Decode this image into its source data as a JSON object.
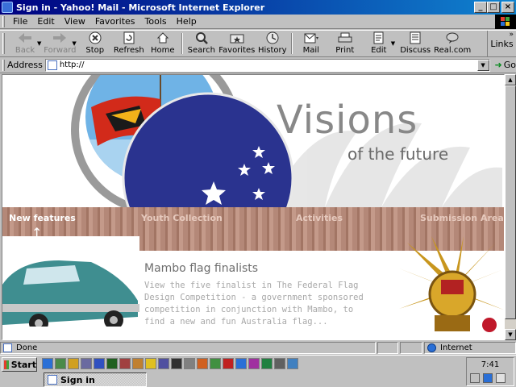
{
  "window": {
    "title": "Sign in - Yahoo! Mail - Microsoft Internet Explorer"
  },
  "menu": [
    "File",
    "Edit",
    "View",
    "Favorites",
    "Tools",
    "Help"
  ],
  "toolbar": {
    "back": "Back",
    "forward": "Forward",
    "stop": "Stop",
    "refresh": "Refresh",
    "home": "Home",
    "search": "Search",
    "favorites": "Favorites",
    "history": "History",
    "mail": "Mail",
    "print": "Print",
    "edit": "Edit",
    "discuss": "Discuss",
    "realcom": "Real.com",
    "links": "Links"
  },
  "address": {
    "label": "Address",
    "value": "http://",
    "go": "Go"
  },
  "page": {
    "hero_title": "Visions",
    "hero_subtitle": "of the future",
    "nav": [
      "New features",
      "Youth Collection",
      "Activities",
      "Submission Area"
    ],
    "feature_title": "Mambo flag finalists",
    "feature_body": "View the five finalist in The Federal Flag Design Competition - a government sponsored competition in conjunction with Mambo, to find a new and fun Australia flag..."
  },
  "status": {
    "text": "Done",
    "zone": "Internet"
  },
  "taskbar": {
    "start": "Start",
    "task": "Sign in",
    "clock": "7:41"
  },
  "colors": {
    "titlebar": "#000080",
    "nav_band": "#b48878",
    "hero_text": "#888888"
  }
}
